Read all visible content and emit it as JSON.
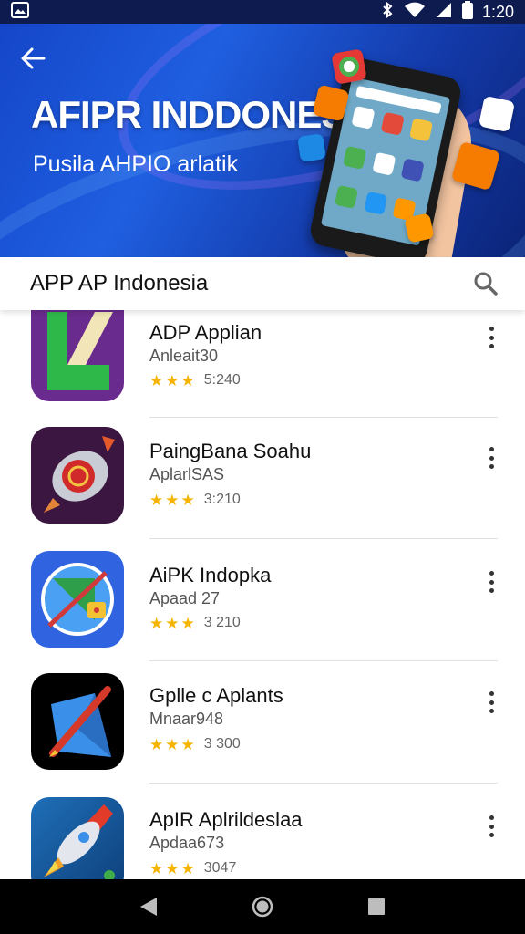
{
  "status_bar": {
    "time": "1:20",
    "icons": [
      "gallery-icon",
      "bluetooth-icon",
      "wifi-icon",
      "signal-icon",
      "battery-icon"
    ]
  },
  "hero": {
    "title": "AFIPR INDDONESIA",
    "subtitle": "Pusila AHPIO arlatik",
    "back_icon": "back-arrow-icon",
    "gradient_colors": [
      "#1546c9",
      "#1f5fe0",
      "#0b2478"
    ]
  },
  "search": {
    "text": "APP AP Indonesia",
    "icon": "search-icon"
  },
  "apps": [
    {
      "name": "ADP Applian",
      "subtitle": "Anleait30",
      "stars": 3,
      "rating_count": "5:240",
      "icon": "green-arrow-app-icon"
    },
    {
      "name": "PaingBana Soahu",
      "subtitle": "AplarlSAS",
      "stars": 3,
      "rating_count": "3:210",
      "icon": "rocket-emblem-app-icon"
    },
    {
      "name": "AiPK Indopka",
      "subtitle": "Apaad 27",
      "stars": 3,
      "rating_count": "3 210",
      "icon": "shield-lock-app-icon"
    },
    {
      "name": "Gplle c Aplants",
      "subtitle": "Mnaar948",
      "stars": 3,
      "rating_count": "3 300",
      "icon": "pencil-app-icon"
    },
    {
      "name": "ApIR Aplrildeslaa",
      "subtitle": "Apdaa673",
      "stars": 3,
      "rating_count": "3047",
      "icon": "rocket-app-icon"
    }
  ],
  "nav_bar": {
    "icons": [
      "nav-back-icon",
      "nav-home-icon",
      "nav-recents-icon"
    ]
  },
  "colors": {
    "accent_blue": "#1546c9",
    "star": "#f4b400",
    "status_bar": "#0d1b4f",
    "nav_bar": "#000000"
  }
}
